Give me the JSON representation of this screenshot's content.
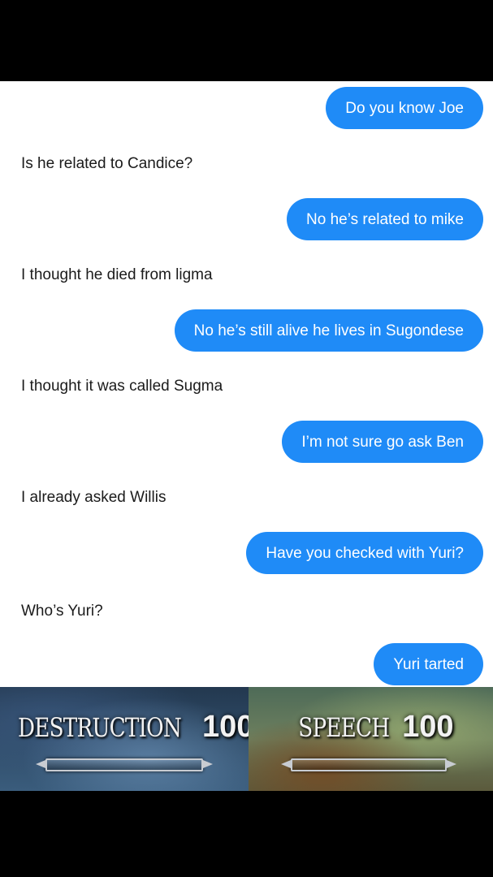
{
  "messages": [
    {
      "side": "out",
      "text": "Do you know Joe"
    },
    {
      "side": "in",
      "text": "Is he related to Candice?"
    },
    {
      "side": "out",
      "text": "No he’s related to mike"
    },
    {
      "side": "in",
      "text": "I thought he died from ligma"
    },
    {
      "side": "out",
      "text": "No he’s still alive he lives in Sugondese"
    },
    {
      "side": "in",
      "text": "I thought it was called Sugma"
    },
    {
      "side": "out",
      "text": "I’m not sure go ask Ben"
    },
    {
      "side": "in",
      "text": "I already asked Willis"
    },
    {
      "side": "out",
      "text": "Have you checked with Yuri?"
    },
    {
      "side": "in",
      "text": "Who’s Yuri?"
    },
    {
      "side": "out",
      "text": "Yuri tarted"
    }
  ],
  "banner": {
    "left": {
      "skill": "DESTRUCTION",
      "level": "100"
    },
    "right": {
      "skill": "SPEECH",
      "level": "100"
    }
  },
  "colors": {
    "outgoing_bubble": "#1f8bf7",
    "incoming_text": "#1b1b1b",
    "background": "#000000",
    "chat_background": "#ffffff"
  }
}
